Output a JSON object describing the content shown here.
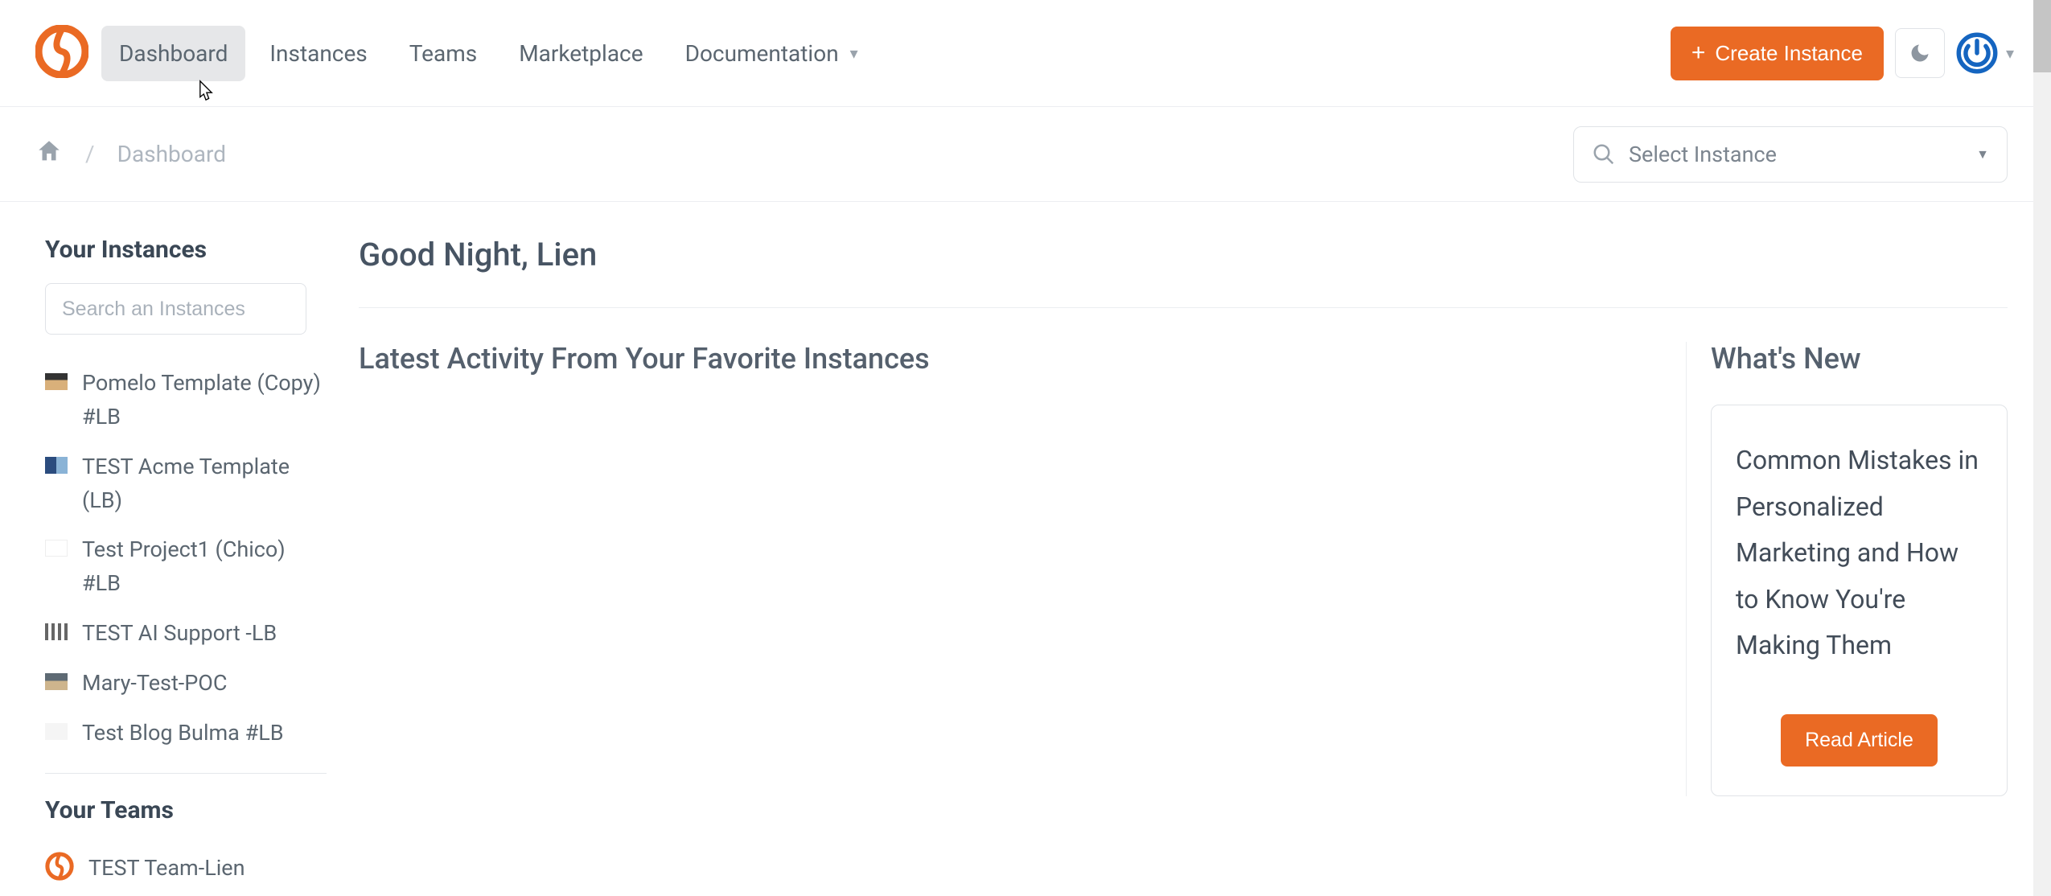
{
  "brand_color": "#ea6a24",
  "header": {
    "nav": {
      "dashboard": "Dashboard",
      "instances": "Instances",
      "teams": "Teams",
      "marketplace": "Marketplace",
      "documentation": "Documentation"
    },
    "create_instance_label": "Create Instance"
  },
  "breadcrumb": {
    "current": "Dashboard"
  },
  "instance_selector": {
    "placeholder": "Select Instance"
  },
  "sidebar": {
    "instances_title": "Your Instances",
    "search_placeholder": "Search an Instances",
    "instances": [
      {
        "label": "Pomelo Template (Copy) #LB"
      },
      {
        "label": "TEST Acme Template (LB)"
      },
      {
        "label": "Test Project1 (Chico) #LB"
      },
      {
        "label": "TEST AI Support -LB"
      },
      {
        "label": "Mary-Test-POC"
      },
      {
        "label": "Test Blog Bulma #LB"
      }
    ],
    "teams_title": "Your Teams",
    "teams": [
      {
        "label": "TEST Team-Lien"
      }
    ]
  },
  "main": {
    "greeting": "Good Night, Lien",
    "activity_title": "Latest Activity From Your Favorite Instances",
    "whats_new_title": "What's New",
    "news": {
      "title": "Common Mistakes in Personalized Marketing and How to Know You're Making Them",
      "button": "Read Article"
    }
  }
}
